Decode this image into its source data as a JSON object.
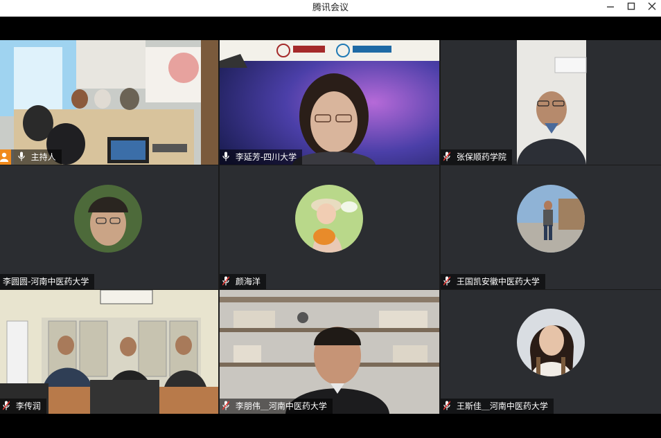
{
  "window": {
    "title": "腾讯会议",
    "minimize_icon": "minimize-icon",
    "maximize_icon": "maximize-icon",
    "close_icon": "close-icon"
  },
  "participants": [
    {
      "name": "主持人",
      "role": "host",
      "mic": "on"
    },
    {
      "name": "李延芳-四川大学",
      "mic": "on",
      "speaking": true
    },
    {
      "name": "张保顺药学院",
      "mic": "muted"
    },
    {
      "name": "李圆圆-河南中医药大学",
      "mic": "none"
    },
    {
      "name": "颜海洋",
      "mic": "muted"
    },
    {
      "name": "王国凯安徽中医药大学",
      "mic": "muted"
    },
    {
      "name": "李传润",
      "mic": "muted"
    },
    {
      "name": "李朋伟＿河南中医药大学",
      "mic": "muted"
    },
    {
      "name": "王斯佳＿河南中医药大学",
      "mic": "muted"
    }
  ],
  "colors": {
    "speaking_border": "#22c55e",
    "host_badge": "#f08a1c",
    "muted_red": "#e53935"
  }
}
